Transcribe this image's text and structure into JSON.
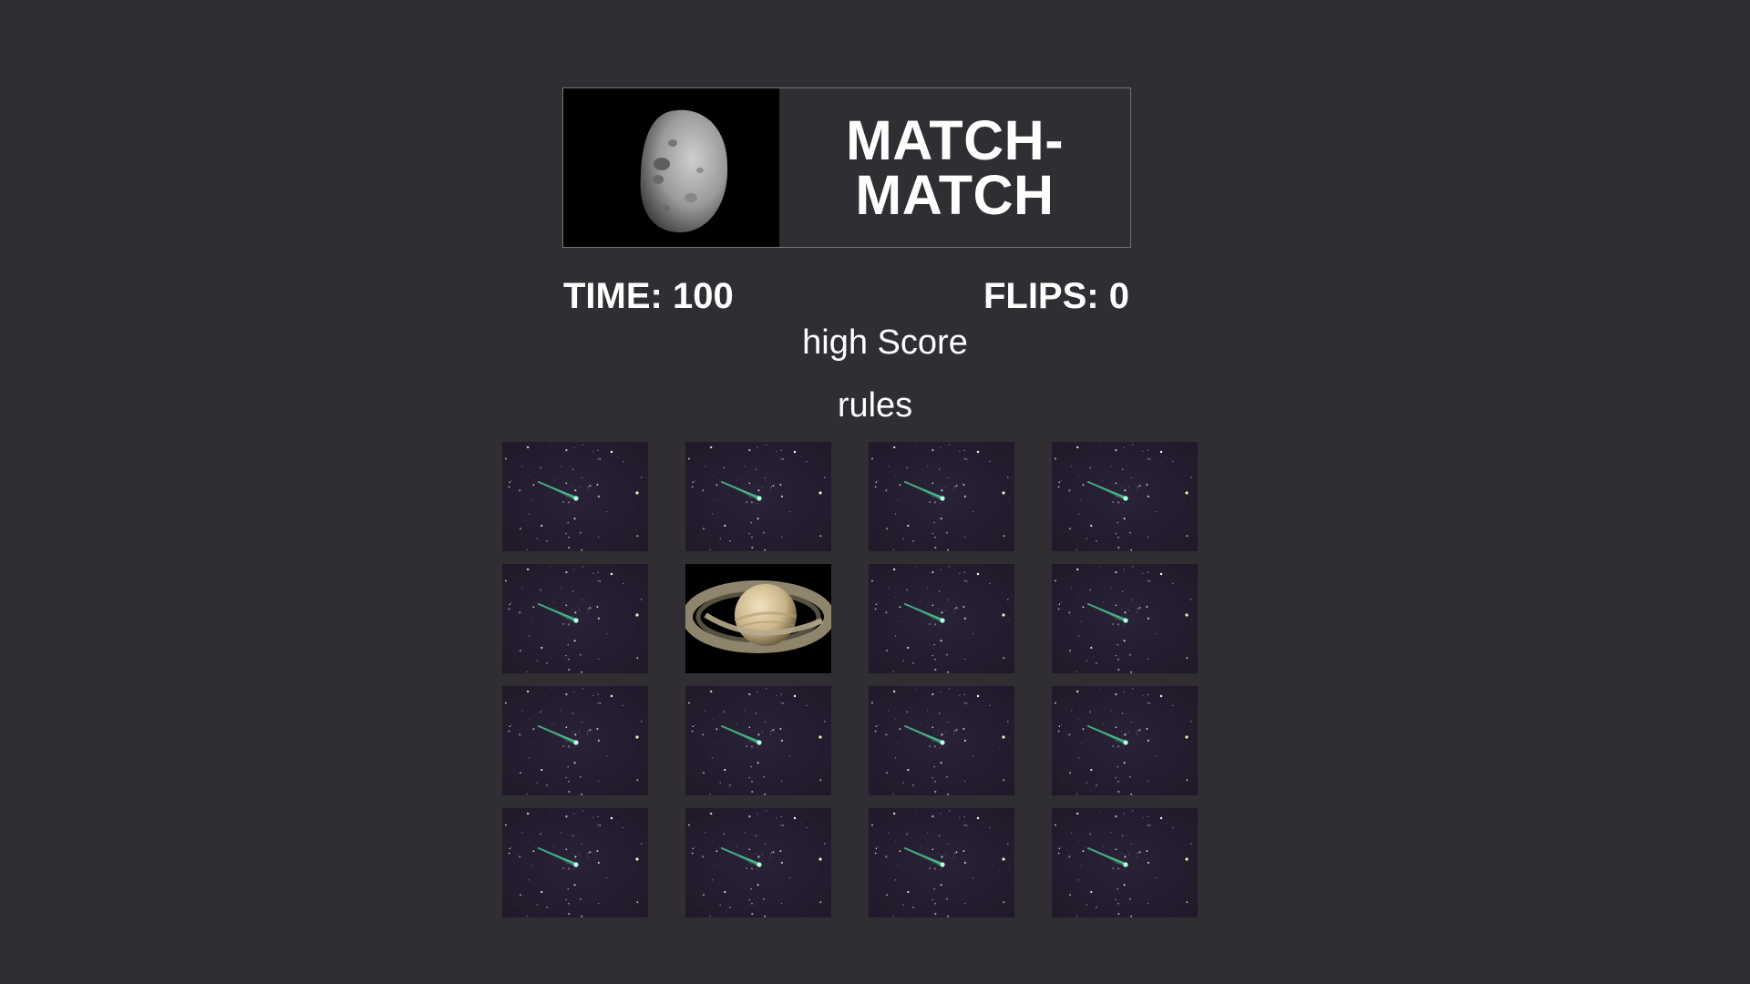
{
  "game": {
    "title": "MATCH-MATCH",
    "logo_icon": "asteroid-icon",
    "time_label": "TIME:",
    "time_value": "100",
    "flips_label": "FLIPS:",
    "flips_value": "0",
    "high_score_link": "high Score",
    "rules_link": "rules"
  },
  "colors": {
    "background": "#302d33",
    "text": "#ffffff",
    "comet_tail": "#4de0a0",
    "card_back_sky": "#1d1828"
  },
  "board": {
    "rows": 4,
    "cols": 4,
    "cards": [
      {
        "face": "comet-card-back",
        "flipped": false
      },
      {
        "face": "comet-card-back",
        "flipped": false
      },
      {
        "face": "comet-card-back",
        "flipped": false
      },
      {
        "face": "comet-card-back",
        "flipped": false
      },
      {
        "face": "comet-card-back",
        "flipped": false
      },
      {
        "face": "saturn-icon",
        "flipped": true
      },
      {
        "face": "comet-card-back",
        "flipped": false
      },
      {
        "face": "comet-card-back",
        "flipped": false
      },
      {
        "face": "comet-card-back",
        "flipped": false
      },
      {
        "face": "comet-card-back",
        "flipped": false
      },
      {
        "face": "comet-card-back",
        "flipped": false
      },
      {
        "face": "comet-card-back",
        "flipped": false
      },
      {
        "face": "comet-card-back",
        "flipped": false
      },
      {
        "face": "comet-card-back",
        "flipped": false
      },
      {
        "face": "comet-card-back",
        "flipped": false
      },
      {
        "face": "comet-card-back",
        "flipped": false
      }
    ]
  }
}
